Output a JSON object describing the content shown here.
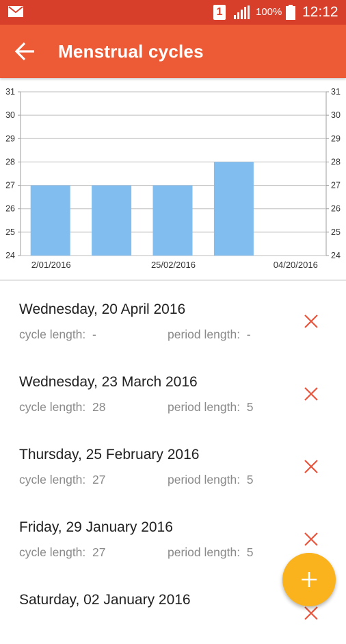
{
  "status_bar": {
    "sim_label": "1",
    "battery": "100%",
    "time": "12:12",
    "icons": [
      "mail-icon",
      "sim-icon",
      "signal-icon",
      "battery-icon"
    ]
  },
  "app_bar": {
    "title": "Menstrual cycles",
    "back_icon": "arrow-back-icon"
  },
  "chart_data": {
    "type": "bar",
    "categories": [
      "02/01/2016",
      "29/01/2016",
      "25/02/2016",
      "23/03/2016"
    ],
    "values": [
      27,
      27,
      27,
      28
    ],
    "x_tick_labels": [
      "2/01/2016",
      "25/02/2016",
      "04/20/2016"
    ],
    "ylim": [
      24,
      31
    ],
    "y_ticks": [
      24,
      25,
      26,
      27,
      28,
      29,
      30,
      31
    ],
    "grid": true,
    "bar_color": "#82bdf0",
    "y_axis_both_sides": true
  },
  "list": {
    "cycle_label": "cycle length:",
    "period_label": "period length:",
    "items": [
      {
        "date": "Wednesday, 20 April 2016",
        "cycle": "-",
        "period": "-"
      },
      {
        "date": "Wednesday, 23 March 2016",
        "cycle": "28",
        "period": "5"
      },
      {
        "date": "Thursday, 25 February 2016",
        "cycle": "27",
        "period": "5"
      },
      {
        "date": "Friday, 29 January 2016",
        "cycle": "27",
        "period": "5"
      },
      {
        "date": "Saturday, 02 January 2016",
        "cycle": "",
        "period": ""
      }
    ]
  },
  "colors": {
    "status_bar": "#d83f2b",
    "app_bar": "#ed5a36",
    "delete_icon": "#e8553c",
    "fab": "#fbb31d"
  },
  "fab_icon": "plus-icon"
}
